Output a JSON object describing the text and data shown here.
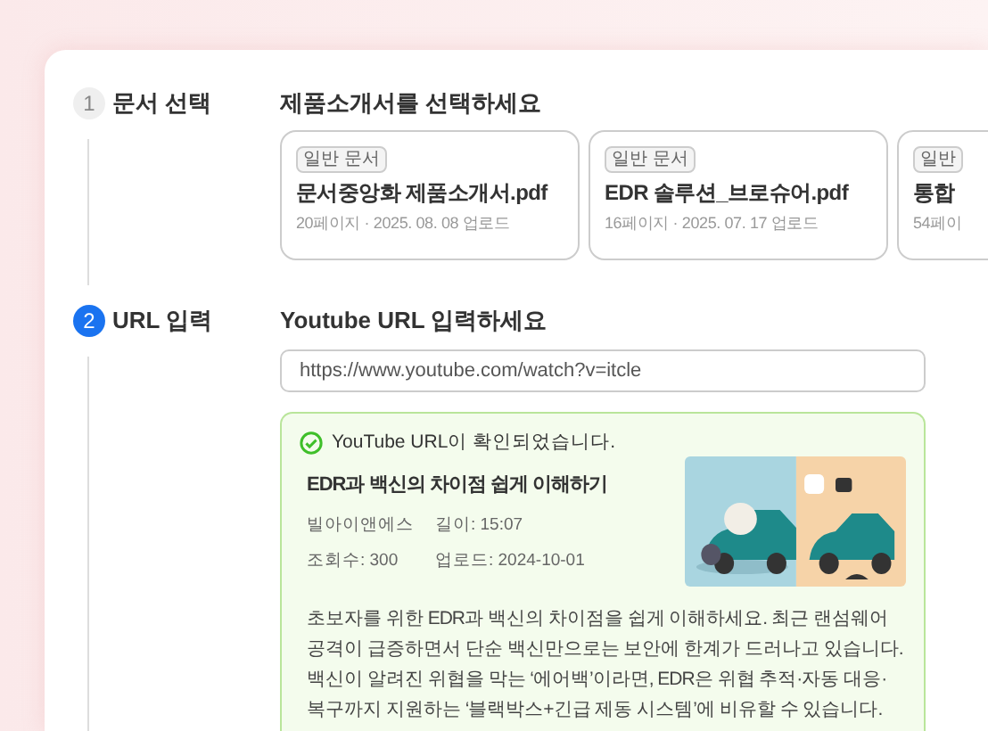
{
  "steps": [
    {
      "number": "1",
      "label": "문서 선택",
      "active": false,
      "heading": "제품소개서를 선택하세요",
      "kind": "documents",
      "documents": [
        {
          "tag": "일반 문서",
          "name": "문서중앙화 제품소개서.pdf",
          "meta": "20페이지 · 2025. 08. 08 업로드"
        },
        {
          "tag": "일반 문서",
          "name": "EDR 솔루션_브로슈어.pdf",
          "meta": "16페이지 · 2025. 07. 17 업로드"
        },
        {
          "tag": "일반",
          "name": "통합",
          "meta": "54페이"
        }
      ]
    },
    {
      "number": "2",
      "label": "URL 입력",
      "active": true,
      "heading": "Youtube URL 입력하세요",
      "kind": "url",
      "url": "https://www.youtube.com/watch?v=itcle",
      "result": {
        "status": "YouTube URL이 확인되었습니다.",
        "title": "EDR과 백신의 차이점 쉽게 이해하기",
        "channel": "빌아이앤에스",
        "length": "길이: 15:07",
        "views": "조회수: 300",
        "uploaded": "업로드: 2024-10-01",
        "description": "초보자를 위한 EDR과 백신의 차이점을 쉽게 이해하세요. 최근 랜섬웨어 공격이 급증하면서 단순 백신만으로는 보안에 한계가 드러나고 있습니다. 백신이 알려진 위협을 막는 ‘에어백’이라면, EDR은 위협 추적·자동 대응·복구까지 지원하는 ‘블랙박스+긴급 제동 시스템’에 비유할 수 있습니다."
      }
    }
  ]
}
